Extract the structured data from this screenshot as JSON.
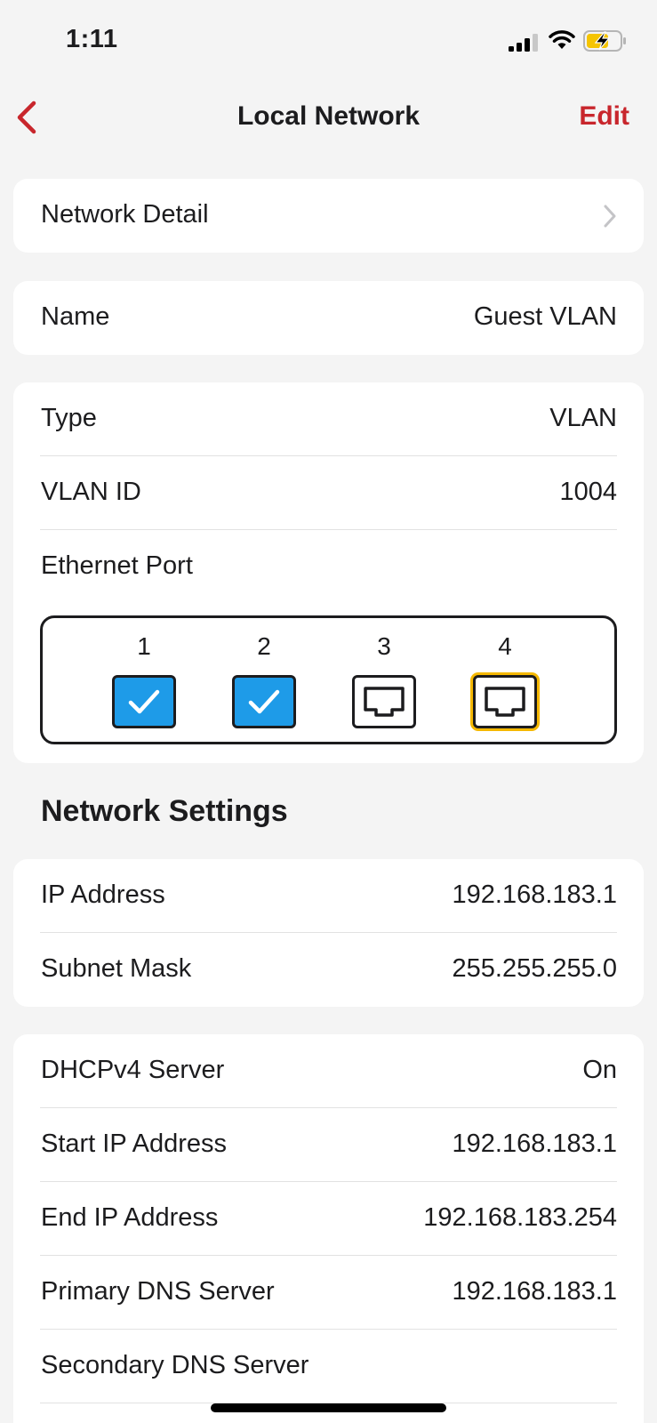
{
  "status_bar": {
    "time": "1:11",
    "icons": [
      "signal-icon",
      "wifi-icon",
      "battery-charging-icon"
    ],
    "battery_color": "#f5c400"
  },
  "nav": {
    "title": "Local Network",
    "edit_label": "Edit",
    "back_icon": "chevron-left-icon",
    "accent_color": "#c8262c"
  },
  "network_detail": {
    "label": "Network Detail",
    "icon": "chevron-right-icon"
  },
  "name_row": {
    "label": "Name",
    "value": "Guest VLAN"
  },
  "vlan_card": {
    "type_label": "Type",
    "type_value": "VLAN",
    "vlan_id_label": "VLAN ID",
    "vlan_id_value": "1004",
    "ethernet_label": "Ethernet Port",
    "ports": [
      {
        "number": "1",
        "state": "checked"
      },
      {
        "number": "2",
        "state": "checked"
      },
      {
        "number": "3",
        "state": "unchecked"
      },
      {
        "number": "4",
        "state": "unchecked-focused"
      }
    ],
    "checked_color": "#1e9be8",
    "focus_color": "#f5b800"
  },
  "network_settings": {
    "header": "Network Settings",
    "ip_label": "IP Address",
    "ip_value": "192.168.183.1",
    "subnet_label": "Subnet Mask",
    "subnet_value": "255.255.255.0"
  },
  "dhcp": {
    "server_label": "DHCPv4 Server",
    "server_value": "On",
    "start_label": "Start IP Address",
    "start_value": "192.168.183.1",
    "end_label": "End IP Address",
    "end_value": "192.168.183.254",
    "primary_dns_label": "Primary DNS Server",
    "primary_dns_value": "192.168.183.1",
    "secondary_dns_label": "Secondary DNS Server",
    "secondary_dns_value": ""
  }
}
